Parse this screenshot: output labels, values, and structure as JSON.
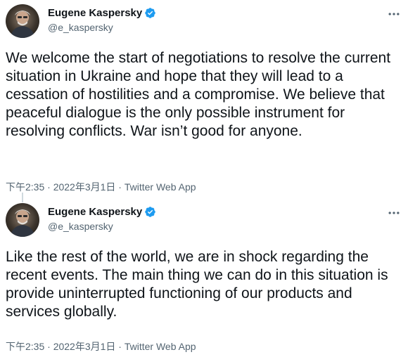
{
  "tweets": [
    {
      "display_name": "Eugene Kaspersky",
      "handle": "@e_kaspersky",
      "text": "We welcome the start of negotiations to resolve the current situation in Ukraine and hope that they will lead to a cessation of hostilities and a compromise. We believe that peaceful dialogue is the only possible instrument for resolving conflicts. War isn’t good for anyone.",
      "meta": "下午2:35 · 2022年3月1日 · Twitter Web App",
      "verified_icon": "verified-badge",
      "more_icon": "more-horizontal"
    },
    {
      "display_name": "Eugene Kaspersky",
      "handle": "@e_kaspersky",
      "text": "Like the rest of the world, we are in shock regarding the recent events. The main thing we can do in this situation is provide uninterrupted functioning of our products and services globally.",
      "meta": "下午2:35 · 2022年3月1日 · Twitter Web App",
      "verified_icon": "verified-badge",
      "more_icon": "more-horizontal"
    }
  ],
  "colors": {
    "text": "#0f1419",
    "secondary": "#536471",
    "verified": "#1d9bf0"
  }
}
